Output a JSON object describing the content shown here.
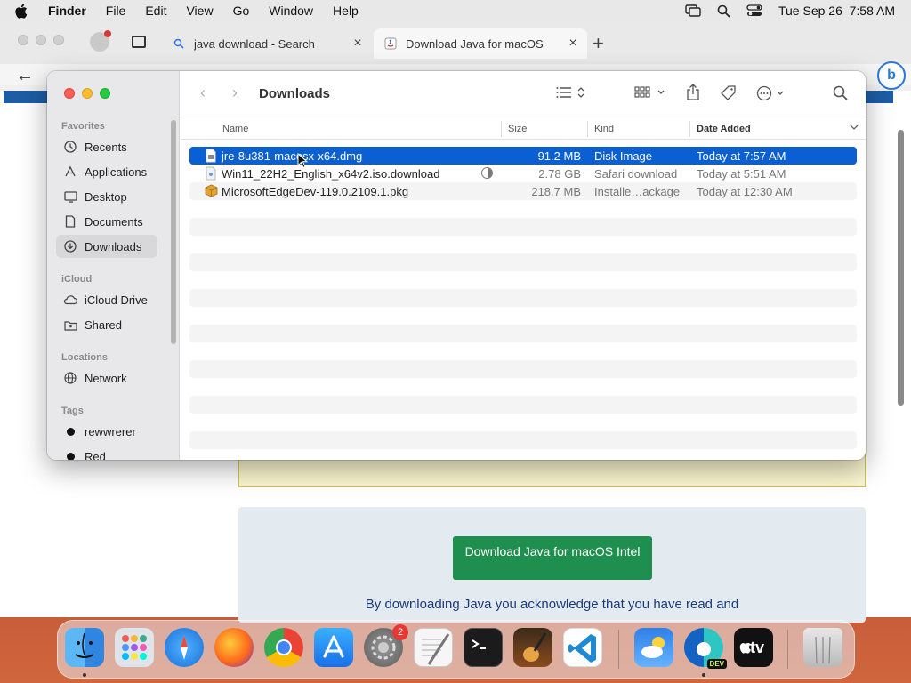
{
  "menubar": {
    "app_name": "Finder",
    "items": [
      "File",
      "Edit",
      "View",
      "Go",
      "Window",
      "Help"
    ],
    "datetime": "Tue Sep 26  7:58 AM"
  },
  "browser": {
    "tabs": [
      {
        "title": "java download - Search",
        "icon": "search-icon"
      },
      {
        "title": "Download Java for macOS",
        "icon": "java-icon"
      }
    ],
    "page": {
      "download_button": "Download Java for macOS Intel",
      "notice_text": "By downloading Java you acknowledge that you have read and"
    }
  },
  "finder": {
    "title": "Downloads",
    "sidebar": {
      "favorites_heading": "Favorites",
      "favorites": [
        {
          "label": "Recents",
          "icon": "clock-icon"
        },
        {
          "label": "Applications",
          "icon": "applications-icon"
        },
        {
          "label": "Desktop",
          "icon": "desktop-icon"
        },
        {
          "label": "Documents",
          "icon": "document-icon"
        },
        {
          "label": "Downloads",
          "icon": "download-icon"
        }
      ],
      "icloud_heading": "iCloud",
      "icloud": [
        {
          "label": "iCloud Drive",
          "icon": "cloud-icon"
        },
        {
          "label": "Shared",
          "icon": "shared-folder-icon"
        }
      ],
      "locations_heading": "Locations",
      "locations": [
        {
          "label": "Network",
          "icon": "globe-icon"
        }
      ],
      "tags_heading": "Tags",
      "tags": [
        {
          "label": "rewwrerer",
          "color": "#111111"
        },
        {
          "label": "Red",
          "color": "#111111"
        }
      ]
    },
    "columns": {
      "name": "Name",
      "size": "Size",
      "kind": "Kind",
      "date": "Date Added"
    },
    "files": [
      {
        "name": "jre-8u381-macosx-x64.dmg",
        "size": "91.2 MB",
        "kind": "Disk Image",
        "date": "Today at 7:57 AM",
        "selected": true,
        "icon": "disk-image-icon"
      },
      {
        "name": "Win11_22H2_English_x64v2.iso.download",
        "size": "2.78 GB",
        "kind": "Safari download",
        "date": "Today at 5:51 AM",
        "selected": false,
        "icon": "download-file-icon",
        "progress": 0.5
      },
      {
        "name": "MicrosoftEdgeDev-119.0.2109.1.pkg",
        "size": "218.7 MB",
        "kind": "Installe…ackage",
        "date": "Today at 12:30 AM",
        "selected": false,
        "icon": "package-icon"
      }
    ]
  },
  "dock": {
    "settings_badge": "2",
    "apps": [
      "Finder",
      "Launchpad",
      "Safari",
      "Firefox",
      "Chrome",
      "App Store",
      "System Settings",
      "TextEdit",
      "Terminal",
      "GarageBand",
      "VS Code",
      "Weather",
      "Edge Dev",
      "Apple TV",
      "Trash"
    ],
    "edge_label": "DEV",
    "tv_label": "tv"
  }
}
